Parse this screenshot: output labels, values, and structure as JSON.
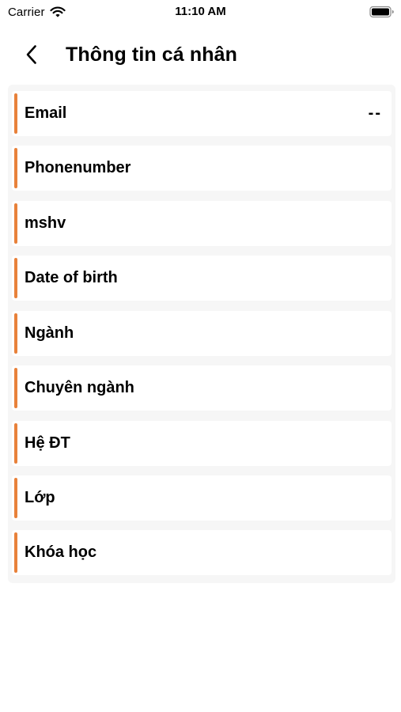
{
  "status_bar": {
    "carrier": "Carrier",
    "time": "11:10 AM",
    "icons": [
      "wifi-icon",
      "battery-icon"
    ]
  },
  "header": {
    "title": "Thông tin cá nhân",
    "back_icon": "chevron-left-icon"
  },
  "theme": {
    "accent": "#e8813a",
    "panel_bg": "#f6f6f6",
    "row_bg": "#ffffff",
    "text": "#000000"
  },
  "fields": [
    {
      "label": "Email",
      "value": "--"
    },
    {
      "label": "Phonenumber",
      "value": ""
    },
    {
      "label": "mshv",
      "value": ""
    },
    {
      "label": "Date of birth",
      "value": ""
    },
    {
      "label": "Ngành",
      "value": ""
    },
    {
      "label": "Chuyên ngành",
      "value": ""
    },
    {
      "label": "Hệ ĐT",
      "value": ""
    },
    {
      "label": "Lớp",
      "value": ""
    },
    {
      "label": "Khóa học",
      "value": ""
    }
  ]
}
